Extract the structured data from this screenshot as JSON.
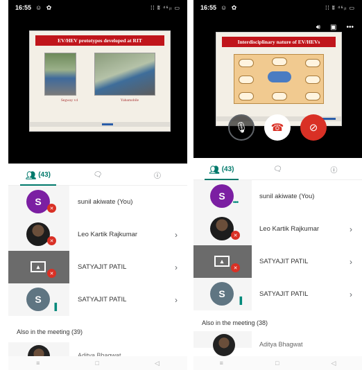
{
  "left": {
    "status_time": "16:55",
    "status_icons": "☺ ✿",
    "status_right": "⁞⁞ ʬ ⁴⁶ᵢₗ ▭",
    "slide_title": "EV/HEV prototypes developed at RIT",
    "slide_captions": [
      "Segway v4",
      "Yabamobile"
    ],
    "tab_people_count": "(43)",
    "participants": [
      {
        "initial": "S",
        "name": "sunil akiwate (You)",
        "avatar": "purple",
        "badge": "mic-off"
      },
      {
        "initial": "",
        "name": "Leo Kartik Rajkumar",
        "avatar": "photo",
        "badge": "mic-off"
      },
      {
        "initial": "",
        "name": "SATYAJIT PATIL",
        "avatar": "screen",
        "badge": "audio-off"
      },
      {
        "initial": "S",
        "name": "SATYAJIT PATIL",
        "avatar": "slate",
        "badge": "speaking"
      }
    ],
    "also_label": "Also in the meeting (39)",
    "partial_name": "Aditya Bhagwat"
  },
  "right": {
    "status_time": "16:55",
    "status_icons": "☺ ✿",
    "status_right": "⁞⁞ ʬ ⁴⁶ᵢₗ ▭",
    "slide_title": "Interdisciplinary nature of EV/HEVs",
    "tab_people_count": "(43)",
    "participants": [
      {
        "initial": "S",
        "name": "sunil akiwate (You)",
        "avatar": "purple",
        "badge": "more"
      },
      {
        "initial": "",
        "name": "Leo Kartik Rajkumar",
        "avatar": "photo",
        "badge": "mic-off"
      },
      {
        "initial": "",
        "name": "SATYAJIT PATIL",
        "avatar": "screen",
        "badge": "audio-off"
      },
      {
        "initial": "S",
        "name": "SATYAJIT PATIL",
        "avatar": "slate",
        "badge": "speaking"
      }
    ],
    "also_label": "Also in the meeting (38)",
    "partial_name": "Aditya Bhagwat"
  },
  "colors": {
    "accent": "#00796b",
    "danger": "#d93025",
    "purple": "#7b1fa2",
    "slate": "#5f7582"
  }
}
